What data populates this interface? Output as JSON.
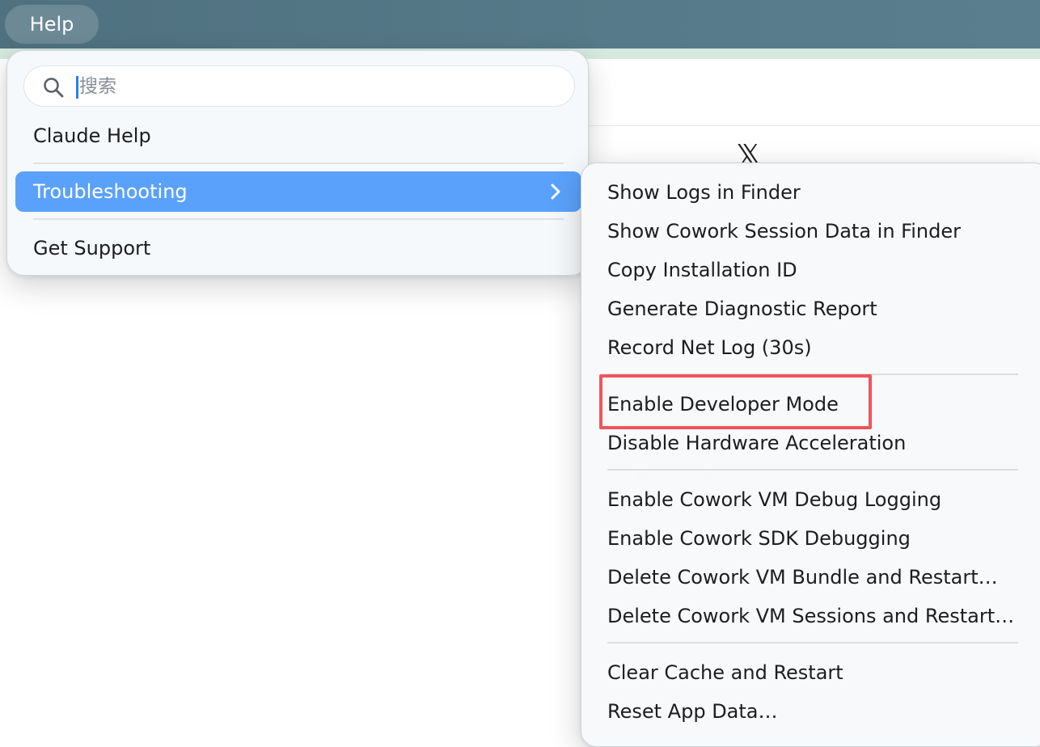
{
  "menubar": {
    "help_label": "Help"
  },
  "help_menu": {
    "search": {
      "placeholder": "搜索",
      "value": ""
    },
    "items": [
      {
        "label": "Claude Help"
      },
      {
        "label": "Troubleshooting",
        "active": true,
        "has_submenu": true
      },
      {
        "label": "Get Support"
      }
    ]
  },
  "submenu": {
    "groups": [
      [
        "Show Logs in Finder",
        "Show Cowork Session Data in Finder",
        "Copy Installation ID",
        "Generate Diagnostic Report",
        "Record Net Log (30s)"
      ],
      [
        "Enable Developer Mode",
        "Disable Hardware Acceleration"
      ],
      [
        "Enable Cowork VM Debug Logging",
        "Enable Cowork SDK Debugging",
        "Delete Cowork VM Bundle and Restart…",
        "Delete Cowork VM Sessions and Restart…"
      ],
      [
        "Clear Cache and Restart",
        "Reset App Data…"
      ]
    ],
    "highlighted_item": "Enable Developer Mode"
  },
  "colors": {
    "menubar": "#567a89",
    "active_item": "#5aa1fb",
    "highlight_border": "#f0545c",
    "caret": "#2c7cf6"
  },
  "icons": {
    "search": "search-icon",
    "submenu_arrow": "chevron-right-icon"
  }
}
